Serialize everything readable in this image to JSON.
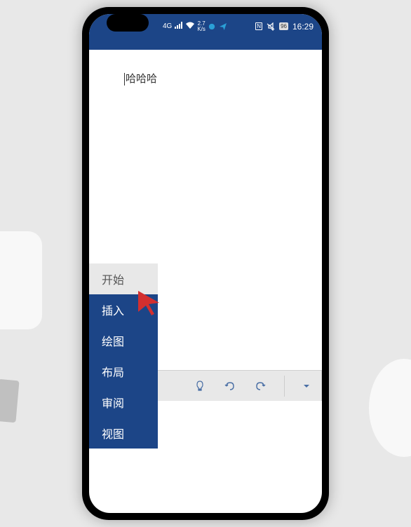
{
  "statusbar": {
    "signal_type": "4G",
    "data_speed_top": "2.7",
    "data_speed_bottom": "K/s",
    "nfc": "N",
    "battery_level": "96",
    "time": "16:29"
  },
  "document": {
    "text": "哈哈哈"
  },
  "menu": {
    "items": [
      {
        "label": "开始",
        "active": true
      },
      {
        "label": "插入",
        "active": false
      },
      {
        "label": "绘图",
        "active": false
      },
      {
        "label": "布局",
        "active": false
      },
      {
        "label": "审阅",
        "active": false
      },
      {
        "label": "视图",
        "active": false
      }
    ]
  }
}
